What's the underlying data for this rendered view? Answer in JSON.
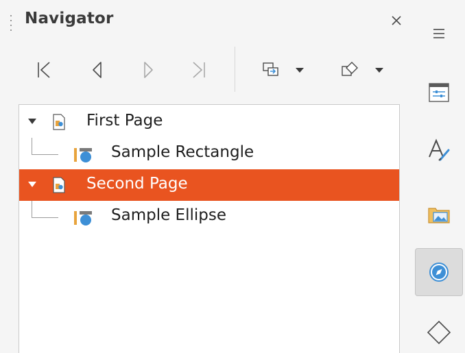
{
  "panel": {
    "title": "Navigator",
    "close_label": "×"
  },
  "toolbar": {
    "buttons": [
      {
        "name": "first-page",
        "icon": "first-icon"
      },
      {
        "name": "previous-page",
        "icon": "previous-icon"
      },
      {
        "name": "next-page",
        "icon": "next-icon"
      },
      {
        "name": "last-page",
        "icon": "last-icon"
      },
      {
        "name": "drag-mode",
        "icon": "drag-mode-icon"
      },
      {
        "name": "shapes-filter",
        "icon": "shapes-icon"
      }
    ]
  },
  "tree": {
    "items": [
      {
        "label": "First Page",
        "type": "page",
        "expanded": true,
        "selected": false
      },
      {
        "label": "Sample Rectangle",
        "type": "shape",
        "selected": false
      },
      {
        "label": "Second Page",
        "type": "page",
        "expanded": true,
        "selected": true
      },
      {
        "label": "Sample Ellipse",
        "type": "shape",
        "selected": false
      }
    ]
  },
  "sidebar_tabs": [
    {
      "name": "menu",
      "icon": "hamburger-icon"
    },
    {
      "name": "properties",
      "icon": "properties-icon"
    },
    {
      "name": "styles",
      "icon": "styles-icon"
    },
    {
      "name": "gallery",
      "icon": "gallery-icon"
    },
    {
      "name": "navigator",
      "icon": "compass-icon",
      "active": true
    },
    {
      "name": "shapes",
      "icon": "diamond-icon"
    }
  ],
  "colors": {
    "selection": "#e95420",
    "accent_orange": "#e8a33c",
    "accent_blue": "#3d8fd6"
  }
}
